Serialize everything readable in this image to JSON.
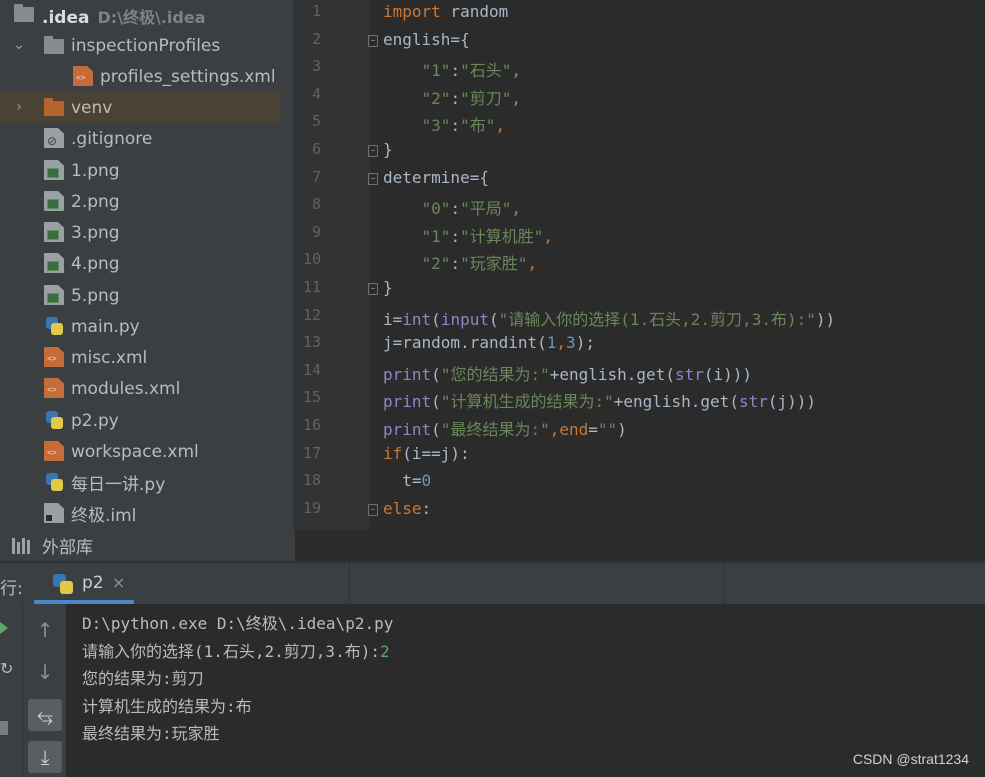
{
  "project_tree": {
    "root": {
      "name": ".idea",
      "path": "D:\\终极\\.idea"
    },
    "items": [
      {
        "label": "inspectionProfiles",
        "icon": "folder-icon"
      },
      {
        "label": "profiles_settings.xml",
        "icon": "xml-file-icon"
      },
      {
        "label": "venv",
        "icon": "folder-icon"
      },
      {
        "label": ".gitignore",
        "icon": "ignore-file-icon"
      },
      {
        "label": "1.png",
        "icon": "image-file-icon"
      },
      {
        "label": "2.png",
        "icon": "image-file-icon"
      },
      {
        "label": "3.png",
        "icon": "image-file-icon"
      },
      {
        "label": "4.png",
        "icon": "image-file-icon"
      },
      {
        "label": "5.png",
        "icon": "image-file-icon"
      },
      {
        "label": "main.py",
        "icon": "python-file-icon"
      },
      {
        "label": "misc.xml",
        "icon": "xml-file-icon"
      },
      {
        "label": "modules.xml",
        "icon": "xml-file-icon"
      },
      {
        "label": "p2.py",
        "icon": "python-file-icon"
      },
      {
        "label": "workspace.xml",
        "icon": "xml-file-icon"
      },
      {
        "label": "每日一讲.py",
        "icon": "python-file-icon"
      },
      {
        "label": "终极.iml",
        "icon": "iml-file-icon"
      }
    ],
    "external_libraries": "外部库"
  },
  "editor": {
    "line_numbers": [
      "1",
      "2",
      "3",
      "4",
      "5",
      "6",
      "7",
      "8",
      "9",
      "10",
      "11",
      "12",
      "13",
      "14",
      "15",
      "16",
      "17",
      "18",
      "19"
    ],
    "code_lines": [
      [
        {
          "t": "import",
          "c": "kw"
        },
        {
          "t": " random",
          "c": ""
        }
      ],
      [
        {
          "t": "english={",
          "c": ""
        }
      ],
      [
        {
          "t": "    ",
          "c": ""
        },
        {
          "t": "\"1\"",
          "c": "st"
        },
        {
          "t": ":",
          "c": ""
        },
        {
          "t": "\"石头\"",
          "c": "st"
        },
        {
          "t": ",",
          "c": "kw"
        }
      ],
      [
        {
          "t": "    ",
          "c": ""
        },
        {
          "t": "\"2\"",
          "c": "st"
        },
        {
          "t": ":",
          "c": ""
        },
        {
          "t": "\"剪刀\"",
          "c": "st"
        },
        {
          "t": ",",
          "c": "kw"
        }
      ],
      [
        {
          "t": "    ",
          "c": ""
        },
        {
          "t": "\"3\"",
          "c": "st"
        },
        {
          "t": ":",
          "c": ""
        },
        {
          "t": "\"布\"",
          "c": "st"
        },
        {
          "t": ",",
          "c": "kw"
        }
      ],
      [
        {
          "t": "}",
          "c": ""
        }
      ],
      [
        {
          "t": "determine={",
          "c": ""
        }
      ],
      [
        {
          "t": "    ",
          "c": ""
        },
        {
          "t": "\"0\"",
          "c": "st"
        },
        {
          "t": ":",
          "c": ""
        },
        {
          "t": "\"平局\"",
          "c": "st"
        },
        {
          "t": ",",
          "c": "kw"
        }
      ],
      [
        {
          "t": "    ",
          "c": ""
        },
        {
          "t": "\"1\"",
          "c": "st"
        },
        {
          "t": ":",
          "c": ""
        },
        {
          "t": "\"计算机胜\"",
          "c": "st"
        },
        {
          "t": ",",
          "c": "kw"
        }
      ],
      [
        {
          "t": "    ",
          "c": ""
        },
        {
          "t": "\"2\"",
          "c": "st"
        },
        {
          "t": ":",
          "c": ""
        },
        {
          "t": "\"玩家胜\"",
          "c": "st"
        },
        {
          "t": ",",
          "c": "kw"
        }
      ],
      [
        {
          "t": "}",
          "c": ""
        }
      ],
      [
        {
          "t": "i=",
          "c": ""
        },
        {
          "t": "int",
          "c": "bi"
        },
        {
          "t": "(",
          "c": ""
        },
        {
          "t": "input",
          "c": "bi"
        },
        {
          "t": "(",
          "c": ""
        },
        {
          "t": "\"请输入你的选择(1.石头,2.剪刀,3.布):\"",
          "c": "st"
        },
        {
          "t": "))",
          "c": ""
        }
      ],
      [
        {
          "t": "j=random.randint(",
          "c": ""
        },
        {
          "t": "1",
          "c": "nu"
        },
        {
          "t": ",",
          "c": "kw"
        },
        {
          "t": "3",
          "c": "nu"
        },
        {
          "t": ");",
          "c": ""
        }
      ],
      [
        {
          "t": "print",
          "c": "bi"
        },
        {
          "t": "(",
          "c": ""
        },
        {
          "t": "\"您的结果为:\"",
          "c": "st"
        },
        {
          "t": "+english.get(",
          "c": ""
        },
        {
          "t": "str",
          "c": "bi"
        },
        {
          "t": "(i)))",
          "c": ""
        }
      ],
      [
        {
          "t": "print",
          "c": "bi"
        },
        {
          "t": "(",
          "c": ""
        },
        {
          "t": "\"计算机生成的结果为:\"",
          "c": "st"
        },
        {
          "t": "+english.get(",
          "c": ""
        },
        {
          "t": "str",
          "c": "bi"
        },
        {
          "t": "(j)))",
          "c": ""
        }
      ],
      [
        {
          "t": "print",
          "c": "bi"
        },
        {
          "t": "(",
          "c": ""
        },
        {
          "t": "\"最终结果为:\"",
          "c": "st"
        },
        {
          "t": ",",
          "c": "kw"
        },
        {
          "t": "end",
          "c": "kw"
        },
        {
          "t": "=",
          "c": ""
        },
        {
          "t": "\"\"",
          "c": "st"
        },
        {
          "t": ")",
          "c": ""
        }
      ],
      [
        {
          "t": "if",
          "c": "kw"
        },
        {
          "t": "(i==j):",
          "c": ""
        }
      ],
      [
        {
          "t": "  t=",
          "c": ""
        },
        {
          "t": "0",
          "c": "nu"
        }
      ],
      [
        {
          "t": "else",
          "c": "kw"
        },
        {
          "t": ":",
          "c": ""
        }
      ]
    ]
  },
  "run_panel": {
    "label": "行:",
    "tab_name": "p2",
    "tab_close": "×",
    "console_lines": [
      {
        "text": "D:\\python.exe D:\\终极\\.idea\\p2.py"
      },
      {
        "text": "请输入你的选择(1.石头,2.剪刀,3.布):",
        "input": "2"
      },
      {
        "text": "您的结果为:剪刀"
      },
      {
        "text": "计算机生成的结果为:布"
      },
      {
        "text": "最终结果为:玩家胜"
      }
    ]
  },
  "watermark": "CSDN @strat1234",
  "colors": {
    "keyword": "#cc7832",
    "string": "#6a8759",
    "number": "#6897bb",
    "builtin": "#8888c6",
    "tab_underline": "#4a88c7"
  }
}
